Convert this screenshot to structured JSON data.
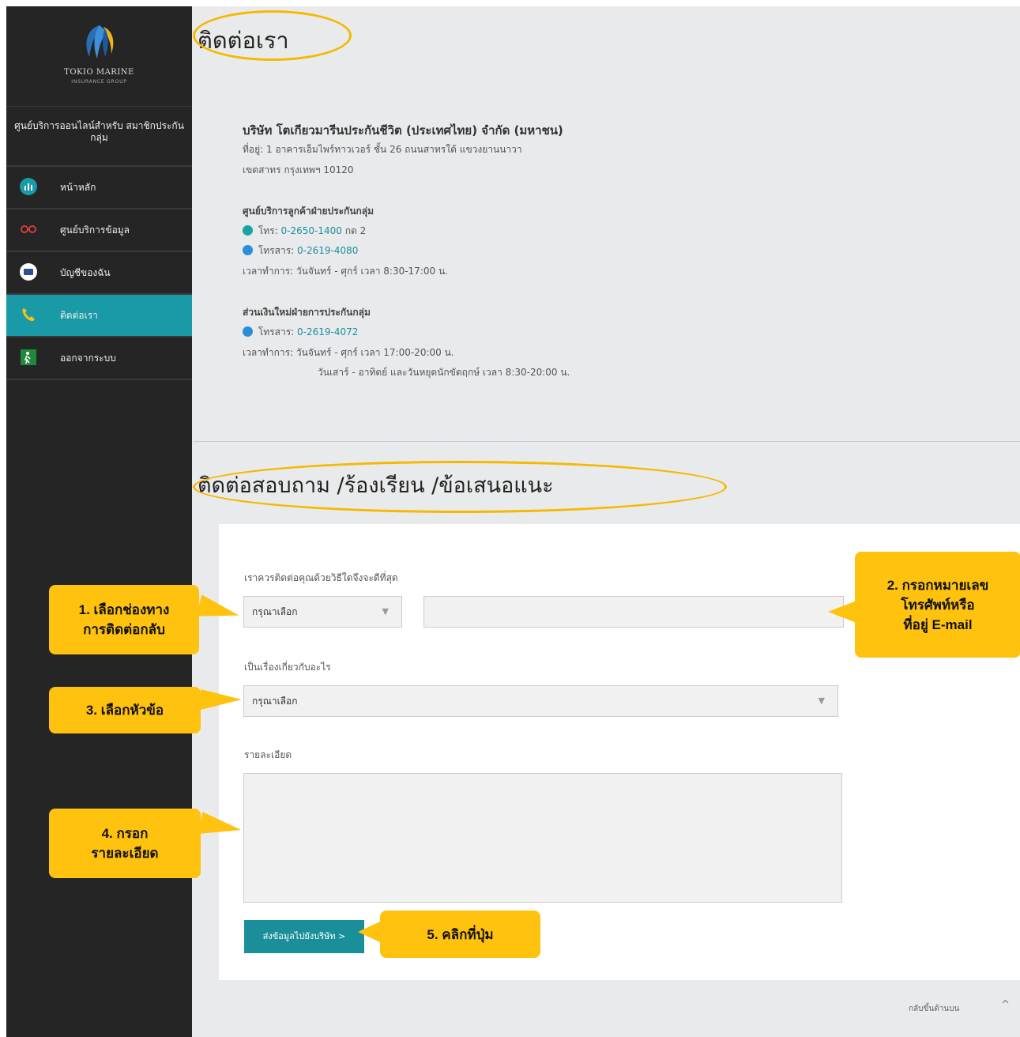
{
  "sidebar": {
    "logo_line1": "TOKIO MARINE",
    "logo_line2": "INSURANCE GROUP",
    "service_title": "ศูนย์บริการออนไลน์สำหรับ สมาชิกประกันกลุ่ม",
    "items": [
      {
        "label": "หน้าหลัก"
      },
      {
        "label": "ศูนย์บริการข้อมูล"
      },
      {
        "label": "บัญชีของฉัน"
      },
      {
        "label": "ติดต่อเรา"
      },
      {
        "label": "ออกจากระบบ"
      }
    ]
  },
  "contact": {
    "title": "ติดต่อเรา",
    "company": "บริษัท โตเกียวมารีนประกันชีวิต (ประเทศไทย) จำกัด (มหาชน)",
    "address1": "ที่อยู่: 1 อาคารเอ็มไพร์ทาวเวอร์ ชั้น 26 ถนนสาทรใต้ แขวงยานนาวา",
    "address2": "เขตสาทร กรุงเทพฯ 10120",
    "center_title": "ศูนย์บริการลูกค้าฝ่ายประกันกลุ่ม",
    "phone_label": "โทร:",
    "phone_value": "0-2650-1400",
    "phone_ext": "กด 2",
    "fax_label": "โทรสาร:",
    "fax_value": "0-2619-4080",
    "hours": "เวลาทำการ: วันจันทร์ - ศุกร์ เวลา 8:30-17:00 น.",
    "renewal_title": "ส่วนเงินใหม่ฝ่ายการประกันกลุ่ม",
    "renewal_fax_label": "โทรสาร:",
    "renewal_fax_value": "0-2619-4072",
    "renewal_hours1": "เวลาทำการ: วันจันทร์ - ศุกร์ เวลา 17:00-20:00 น.",
    "renewal_hours2": "วันเสาร์ - อาทิตย์ และวันหยุดนักขัตฤกษ์ เวลา 8:30-20:00 น."
  },
  "form": {
    "title": "ติดต่อสอบถาม /ร้องเรียน /ข้อเสนอแนะ",
    "contact_method_label": "เราควรติดต่อคุณด้วยวิธีใดจึงจะดีที่สุด",
    "contact_method_value": "กรุณาเลือก",
    "contact_value": "",
    "topic_label": "เป็นเรื่องเกี่ยวกับอะไร",
    "topic_value": "กรุณาเลือก",
    "detail_label": "รายละเอียด",
    "detail_value": "",
    "submit_label": "ส่งข้อมูลไปยังบริษัท >"
  },
  "footer": {
    "back_to_top": "กลับขึ้นด้านบน"
  },
  "callouts": {
    "c1": "1. เลือกช่องทาง\nการติดต่อกลับ",
    "c2": "2. กรอกหมายเลข\nโทรศัพท์หรือ\nที่อยู่ E-mail",
    "c3": "3. เลือกหัวข้อ",
    "c4": "4. กรอก\nรายละเอียด",
    "c5": "5. คลิกที่ปุ่ม"
  },
  "colors": {
    "sidebar": "#252525",
    "accent": "#1a9aa6",
    "callout": "#ffc20e",
    "highlight_ring": "#f5b900"
  }
}
